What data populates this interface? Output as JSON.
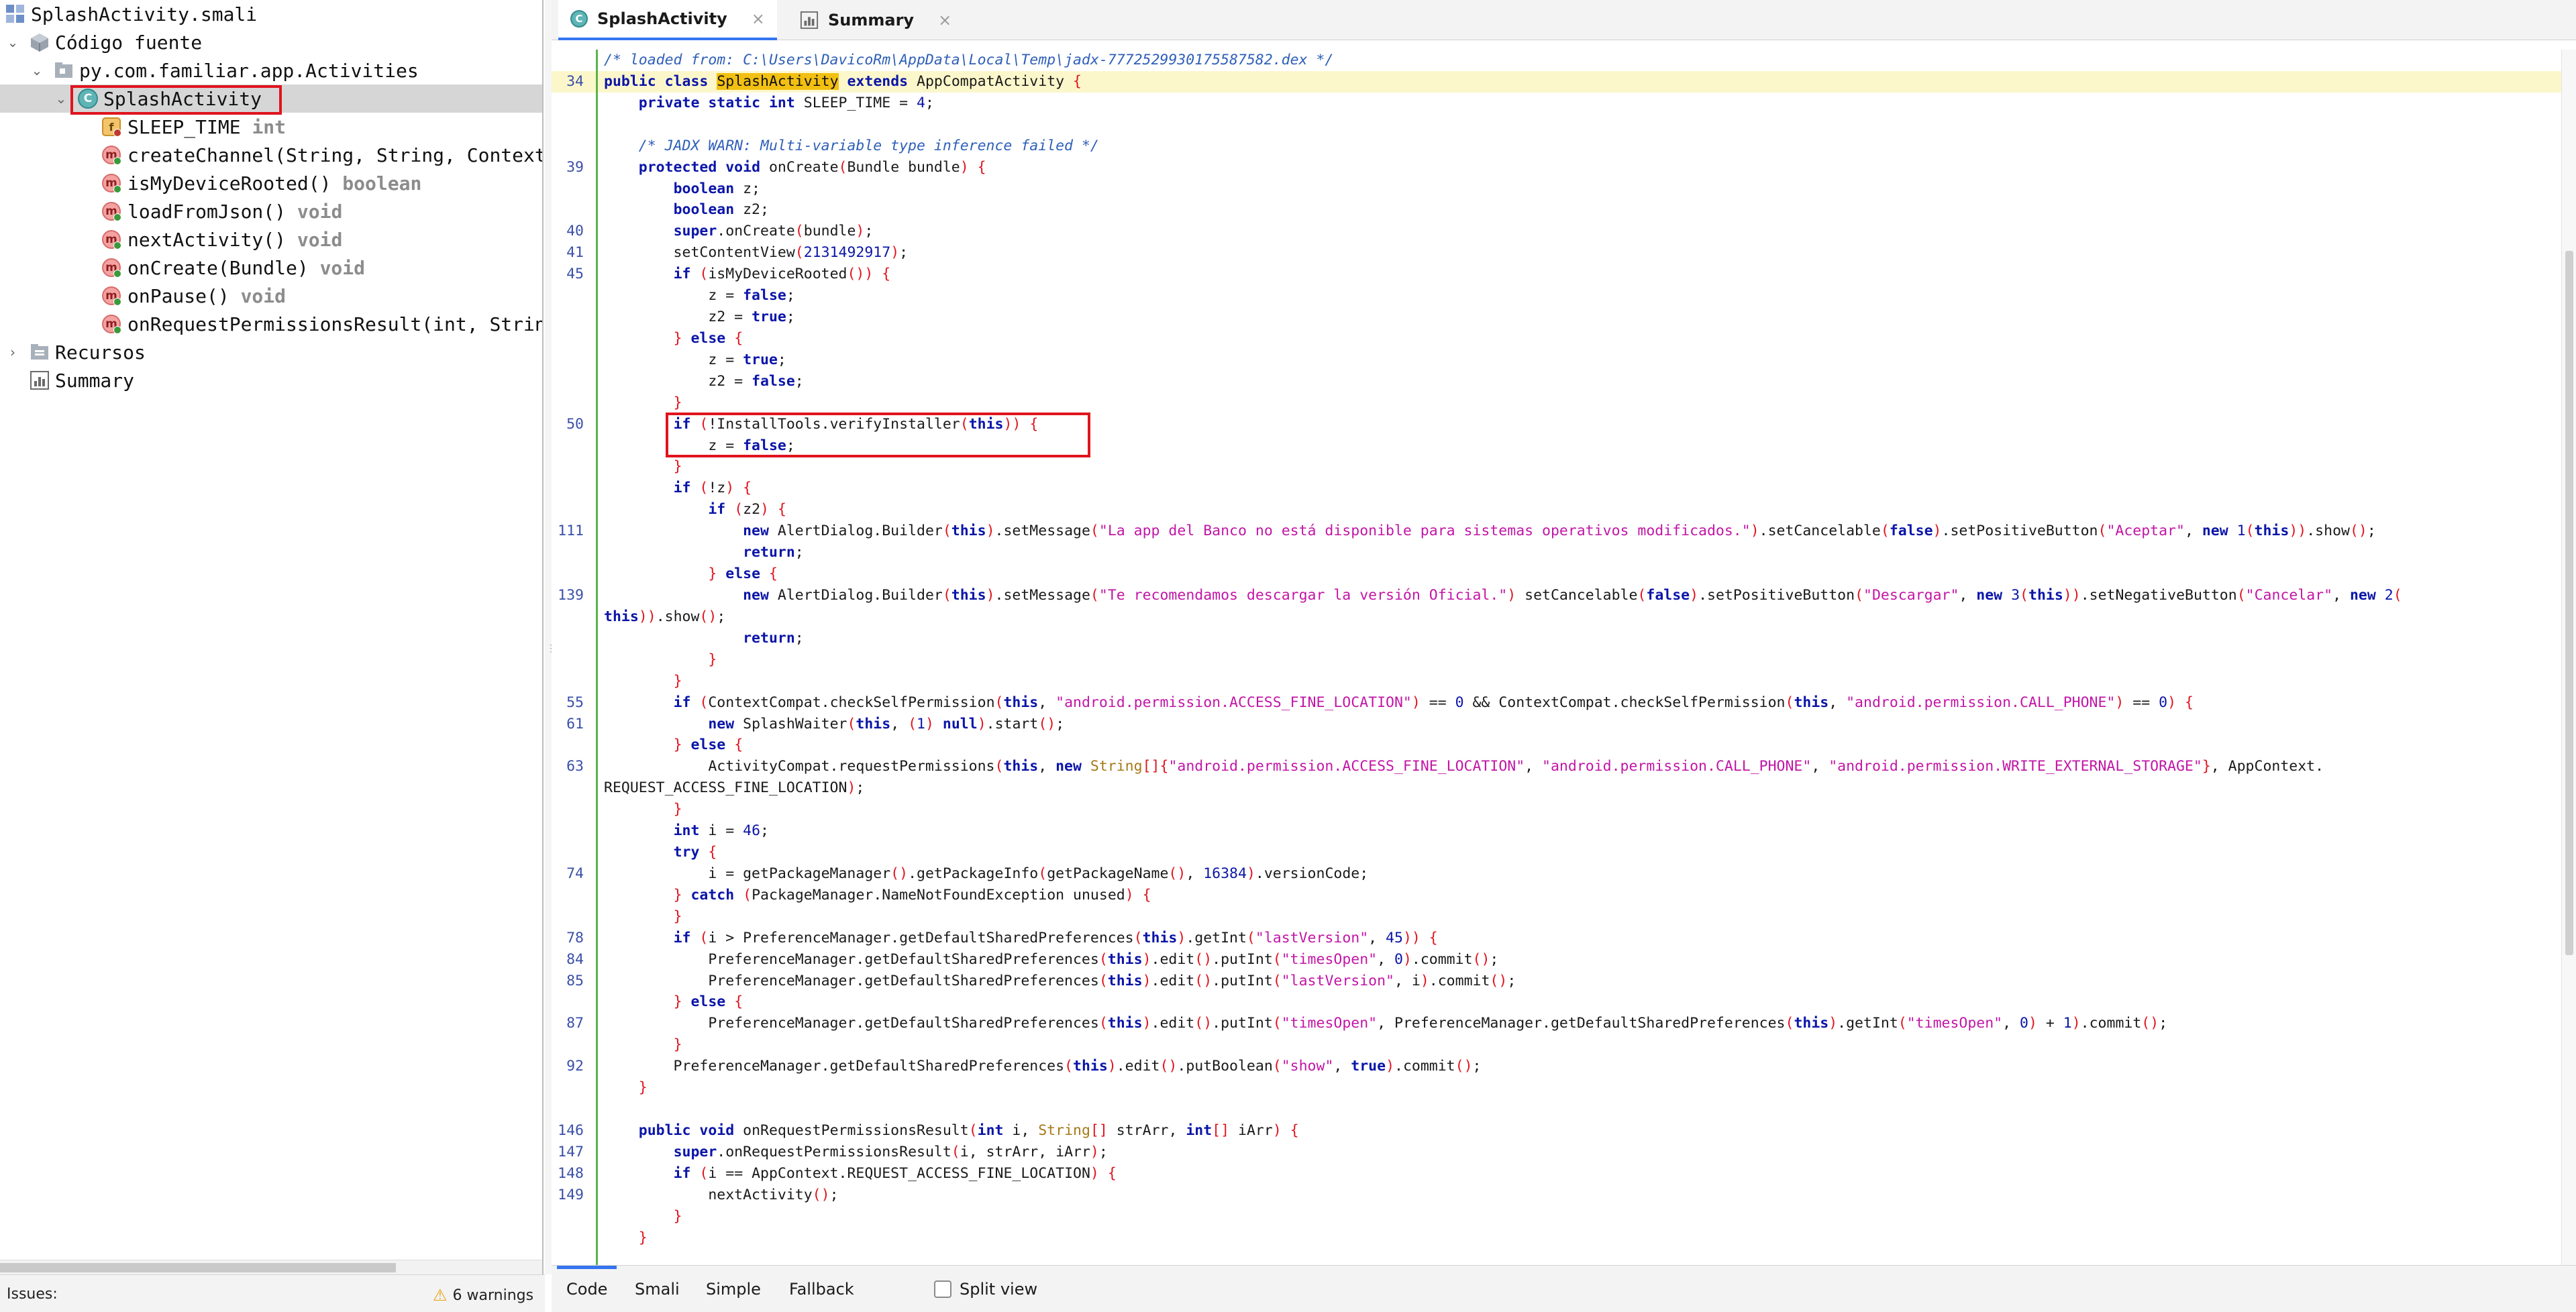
{
  "tree": {
    "root": "SplashActivity.smali",
    "source": "Código fuente",
    "package": "py.com.familiar.app.Activities",
    "class": "SplashActivity",
    "members": [
      {
        "icon": "f",
        "name": "SLEEP_TIME",
        "type": "int"
      },
      {
        "icon": "m",
        "name": "createChannel(String, String, Context",
        "type": ""
      },
      {
        "icon": "m",
        "name": "isMyDeviceRooted()",
        "type": "boolean"
      },
      {
        "icon": "m",
        "name": "loadFromJson()",
        "type": "void"
      },
      {
        "icon": "m",
        "name": "nextActivity()",
        "type": "void"
      },
      {
        "icon": "m",
        "name": "onCreate(Bundle)",
        "type": "void"
      },
      {
        "icon": "m",
        "name": "onPause()",
        "type": "void"
      },
      {
        "icon": "m",
        "name": "onRequestPermissionsResult(int, Strin",
        "type": ""
      }
    ],
    "resources": "Recursos",
    "summary": "Summary"
  },
  "tabs": [
    {
      "label": "SplashActivity",
      "close": "×"
    },
    {
      "label": "Summary",
      "close": "×"
    }
  ],
  "code": {
    "line_numbers": [
      "34",
      "39",
      "40",
      "41",
      "45",
      "50",
      "111",
      "139",
      "55",
      "61",
      "63",
      "74",
      "78",
      "84",
      "85",
      "87",
      "92",
      "146",
      "147",
      "148",
      "149"
    ],
    "lines": [
      "/* loaded from: C:\\Users\\DavicoRm\\AppData\\Local\\Temp\\jadx-7772529930175587582.dex */",
      "public class SplashActivity extends AppCompatActivity {",
      "    private static int SLEEP_TIME = 4;",
      "",
      "    /* JADX WARN: Multi-variable type inference failed */",
      "    protected void onCreate(Bundle bundle) {",
      "        boolean z;",
      "        boolean z2;",
      "        super.onCreate(bundle);",
      "        setContentView(2131492917);",
      "        if (isMyDeviceRooted()) {",
      "            z = false;",
      "            z2 = true;",
      "        } else {",
      "            z = true;",
      "            z2 = false;",
      "        }",
      "        if (!InstallTools.verifyInstaller(this)) {",
      "            z = false;",
      "        }",
      "        if (!z) {",
      "            if (z2) {",
      "                new AlertDialog.Builder(this).setMessage(\"La app del Banco no está disponible para sistemas operativos modificados.\").setCancelable(false).setPositiveButton(\"Aceptar\", new 1(this)).show();",
      "                return;",
      "            } else {",
      "                new AlertDialog.Builder(this).setMessage(\"Te recomendamos descargar la versión Oficial.\") setCancelable(false).setPositiveButton(\"Descargar\", new 3(this)).setNegativeButton(\"Cancelar\", new 2(",
      "this)).show();",
      "                return;",
      "            }",
      "        }",
      "        if (ContextCompat.checkSelfPermission(this, \"android.permission.ACCESS_FINE_LOCATION\") == 0 && ContextCompat.checkSelfPermission(this, \"android.permission.CALL_PHONE\") == 0) {",
      "            new SplashWaiter(this, (1) null).start();",
      "        } else {",
      "            ActivityCompat.requestPermissions(this, new String[]{\"android.permission.ACCESS_FINE_LOCATION\", \"android.permission.CALL_PHONE\", \"android.permission.WRITE_EXTERNAL_STORAGE\"}, AppContext.",
      "REQUEST_ACCESS_FINE_LOCATION);",
      "        }",
      "        int i = 46;",
      "        try {",
      "            i = getPackageManager().getPackageInfo(getPackageName(), 16384).versionCode;",
      "        } catch (PackageManager.NameNotFoundException unused) {",
      "        }",
      "        if (i > PreferenceManager.getDefaultSharedPreferences(this).getInt(\"lastVersion\", 45)) {",
      "            PreferenceManager.getDefaultSharedPreferences(this).edit().putInt(\"timesOpen\", 0).commit();",
      "            PreferenceManager.getDefaultSharedPreferences(this).edit().putInt(\"lastVersion\", i).commit();",
      "        } else {",
      "            PreferenceManager.getDefaultSharedPreferences(this).edit().putInt(\"timesOpen\", PreferenceManager.getDefaultSharedPreferences(this).getInt(\"timesOpen\", 0) + 1).commit();",
      "        }",
      "        PreferenceManager.getDefaultSharedPreferences(this).edit().putBoolean(\"show\", true).commit();",
      "    }",
      "",
      "    public void onRequestPermissionsResult(int i, String[] strArr, int[] iArr) {",
      "        super.onRequestPermissionsResult(i, strArr, iArr);",
      "        if (i == AppContext.REQUEST_ACCESS_FINE_LOCATION) {",
      "            nextActivity();",
      "        }",
      "    }"
    ]
  },
  "view_tabs": [
    "Code",
    "Smali",
    "Simple",
    "Fallback"
  ],
  "split_view": {
    "label": "Split view",
    "checked": false
  },
  "status": {
    "issues_label": "Issues:",
    "warnings": "6 warnings"
  }
}
